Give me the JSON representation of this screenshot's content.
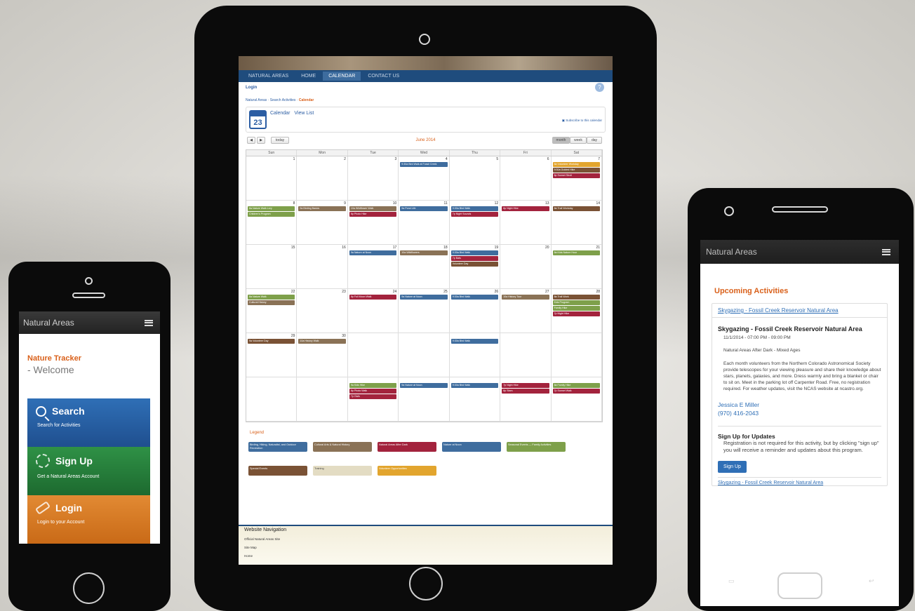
{
  "colors": {
    "accent_orange": "#d9601a",
    "nav_blue": "#1f4c7d",
    "link_blue": "#2f6fb6"
  },
  "iphone": {
    "app_title": "Natural Areas",
    "menu_icon": "hamburger-icon",
    "heading": "Nature Tracker",
    "subheading": "- Welcome",
    "tiles": [
      {
        "label": "Search",
        "desc": "Search for Activities",
        "icon": "search-icon"
      },
      {
        "label": "Sign Up",
        "desc": "Get a Natural Areas Account",
        "icon": "signup-icon"
      },
      {
        "label": "Login",
        "desc": "Login to your Account",
        "icon": "login-icon"
      }
    ]
  },
  "ipad": {
    "nav": [
      "NATURAL AREAS",
      "HOME",
      "CALENDAR",
      "CONTACT US"
    ],
    "login": "Login",
    "breadcrumb_prefix": "Natural Areas · Search Activities · ",
    "breadcrumb_current": "Calendar",
    "calendar_icon_day": "23",
    "view_tabs": [
      "Calendar",
      "View List"
    ],
    "subscribe": "Subscribe to this calendar",
    "prev": "◀",
    "next": "▶",
    "today": "today",
    "month_title": "June 2014",
    "views": [
      "month",
      "week",
      "day"
    ],
    "weekdays": [
      "Sun",
      "Mon",
      "Tue",
      "Wed",
      "Thu",
      "Fri",
      "Sat"
    ],
    "day_numbers": [
      [
        "1",
        "2",
        "3",
        "4",
        "5",
        "6",
        "7"
      ],
      [
        "8",
        "9",
        "10",
        "11",
        "12",
        "13",
        "14"
      ],
      [
        "15",
        "16",
        "17",
        "18",
        "19",
        "20",
        "21"
      ],
      [
        "22",
        "23",
        "24",
        "25",
        "26",
        "27",
        "28"
      ],
      [
        "29",
        "30",
        "",
        "",
        "",
        "",
        ""
      ],
      [
        "",
        "",
        "",
        "",
        "",
        "",
        ""
      ]
    ],
    "events": [
      {
        "week": 0,
        "day": 3,
        "rows": [
          {
            "c": "#3f6d9e",
            "t": "9:30a Bird Walk at Fossil Creek"
          }
        ]
      },
      {
        "week": 0,
        "day": 6,
        "rows": [
          {
            "c": "#e2a52e",
            "t": "8a Volunteer Workday"
          },
          {
            "c": "#7a5235",
            "t": "9:30a Guided Hike"
          },
          {
            "c": "#a3233d",
            "t": "6p Sunset Stroll"
          }
        ]
      },
      {
        "week": 1,
        "day": 0,
        "rows": [
          {
            "c": "#7ea04a",
            "t": "8a Nature Walk Lory"
          },
          {
            "c": "#7ea04a",
            "t": "Children's Program"
          }
        ]
      },
      {
        "week": 1,
        "day": 1,
        "rows": [
          {
            "c": "#8a7256",
            "t": "9a Birding Basics"
          }
        ]
      },
      {
        "week": 1,
        "day": 2,
        "rows": [
          {
            "c": "#8a7256",
            "t": "10a Wildflower Walk"
          },
          {
            "c": "#a3233d",
            "t": "6p Photo Hike"
          }
        ]
      },
      {
        "week": 1,
        "day": 3,
        "rows": [
          {
            "c": "#3f6d9e",
            "t": "9a Pond Life"
          }
        ]
      },
      {
        "week": 1,
        "day": 4,
        "rows": [
          {
            "c": "#3f6d9e",
            "t": "9:30a Bird Walk"
          },
          {
            "c": "#a3233d",
            "t": "7p Night Sounds"
          }
        ]
      },
      {
        "week": 1,
        "day": 5,
        "rows": [
          {
            "c": "#a3233d",
            "t": "8p Night Hike"
          }
        ]
      },
      {
        "week": 1,
        "day": 6,
        "rows": [
          {
            "c": "#7a5235",
            "t": "8a Trail Workday"
          }
        ]
      },
      {
        "week": 2,
        "day": 2,
        "rows": [
          {
            "c": "#3f6d9e",
            "t": "9a Nature at Noon"
          }
        ]
      },
      {
        "week": 2,
        "day": 3,
        "rows": [
          {
            "c": "#8a7256",
            "t": "10a Wildflowers"
          }
        ]
      },
      {
        "week": 2,
        "day": 4,
        "rows": [
          {
            "c": "#3f6d9e",
            "t": "9:30a Bird Walk"
          },
          {
            "c": "#a3233d",
            "t": "7p Bats"
          },
          {
            "c": "#7a5235",
            "t": "Volunteer Day"
          }
        ]
      },
      {
        "week": 2,
        "day": 6,
        "rows": [
          {
            "c": "#7ea04a",
            "t": "8a Kids Nature Hour"
          }
        ]
      },
      {
        "week": 3,
        "day": 0,
        "rows": [
          {
            "c": "#7ea04a",
            "t": "8a Nature Walk"
          },
          {
            "c": "#8a7256",
            "t": "Cultural History"
          }
        ]
      },
      {
        "week": 3,
        "day": 2,
        "rows": [
          {
            "c": "#a3233d",
            "t": "8p Full Moon Walk"
          }
        ]
      },
      {
        "week": 3,
        "day": 3,
        "rows": [
          {
            "c": "#3f6d9e",
            "t": "9a Nature at Noon"
          }
        ]
      },
      {
        "week": 3,
        "day": 4,
        "rows": [
          {
            "c": "#3f6d9e",
            "t": "9:30a Bird Walk"
          }
        ]
      },
      {
        "week": 3,
        "day": 5,
        "rows": [
          {
            "c": "#8a7256",
            "t": "10a History Tour"
          }
        ]
      },
      {
        "week": 3,
        "day": 6,
        "rows": [
          {
            "c": "#7a5235",
            "t": "8a Trail Work"
          },
          {
            "c": "#7ea04a",
            "t": "Kids Program"
          },
          {
            "c": "#7ea04a",
            "t": "Family Hike"
          },
          {
            "c": "#a3233d",
            "t": "7p Night Hike"
          }
        ]
      },
      {
        "week": 4,
        "day": 0,
        "rows": [
          {
            "c": "#7a5235",
            "t": "9a Volunteer Day"
          }
        ]
      },
      {
        "week": 4,
        "day": 1,
        "rows": [
          {
            "c": "#8a7256",
            "t": "10a History Walk"
          }
        ]
      },
      {
        "week": 4,
        "day": 4,
        "rows": [
          {
            "c": "#3f6d9e",
            "t": "9:30a Bird Walk"
          }
        ]
      },
      {
        "week": 5,
        "day": 2,
        "rows": [
          {
            "c": "#7ea04a",
            "t": "9a Kids Hike"
          },
          {
            "c": "#a3233d",
            "t": "6p Photo Walk"
          },
          {
            "c": "#a3233d",
            "t": "7p Owls"
          }
        ]
      },
      {
        "week": 5,
        "day": 3,
        "rows": [
          {
            "c": "#3f6d9e",
            "t": "9a Nature at Noon"
          }
        ]
      },
      {
        "week": 5,
        "day": 4,
        "rows": [
          {
            "c": "#3f6d9e",
            "t": "9:30a Bird Walk"
          }
        ]
      },
      {
        "week": 5,
        "day": 5,
        "rows": [
          {
            "c": "#a3233d",
            "t": "7p Night Hike"
          },
          {
            "c": "#a3233d",
            "t": "8p Stars"
          }
        ]
      },
      {
        "week": 5,
        "day": 6,
        "rows": [
          {
            "c": "#7ea04a",
            "t": "8a Family Hike"
          },
          {
            "c": "#a3233d",
            "t": "7p Sunset Walk"
          }
        ]
      }
    ],
    "legend_title": "Legend",
    "legend": [
      {
        "label": "Birding, Hiking, Naturalist, and Outdoor Recreation",
        "color": "#3f6d9e"
      },
      {
        "label": "Cultural Arts & Natural History",
        "color": "#8a7256"
      },
      {
        "label": "Natural Areas After Dark",
        "color": "#a3233d"
      },
      {
        "label": "Nature at Noon",
        "color": "#3f6d9e"
      },
      {
        "label": "Seasonal Events — Family Activities",
        "color": "#7ea04a"
      },
      {
        "label": "Special Events",
        "color": "#7a5235"
      },
      {
        "label": "Training",
        "color": "#e3dcc3"
      },
      {
        "label": "Volunteer Opportunities",
        "color": "#e2a52e"
      }
    ],
    "footer_title": "Website Navigation",
    "footer_links": [
      "Official Natural Areas Site",
      "Site Map",
      "Home"
    ]
  },
  "android": {
    "app_title": "Natural Areas",
    "menu_icon": "hamburger-icon",
    "section_title": "Upcoming Activities",
    "event_link": "Skygazing - Fossil Creek Reservoir Natural Area",
    "event_title": "Skygazing - Fossil Creek Reservoir Natural Area",
    "event_date": "11/1/2014 - 07:00 PM - 09:00 PM",
    "event_category": "Natural Areas After Dark - Mixed Ages",
    "event_desc": "Each month volunteers from the Northern Colorado Astronomical Society provide telescopes for your viewing pleasure and share their knowledge about stars, planets, galaxies, and more. Dress warmly and bring a blanket or chair to sit on. Meet in the parking lot off Carpenter Road. Free, no registration required. For weather updates, visit the NCAS website at ncastro.org.",
    "contact_name": "Jessica E Miller",
    "contact_phone": "(970) 416-2043",
    "signup_title": "Sign Up for Updates",
    "signup_text": "Registration is not required for this activity, but by clicking \"sign up\" you will receive a reminder and updates about this program.",
    "signup_button": "Sign Up",
    "next_link": "Skygazing - Fossil Creek Reservoir Natural Area"
  }
}
